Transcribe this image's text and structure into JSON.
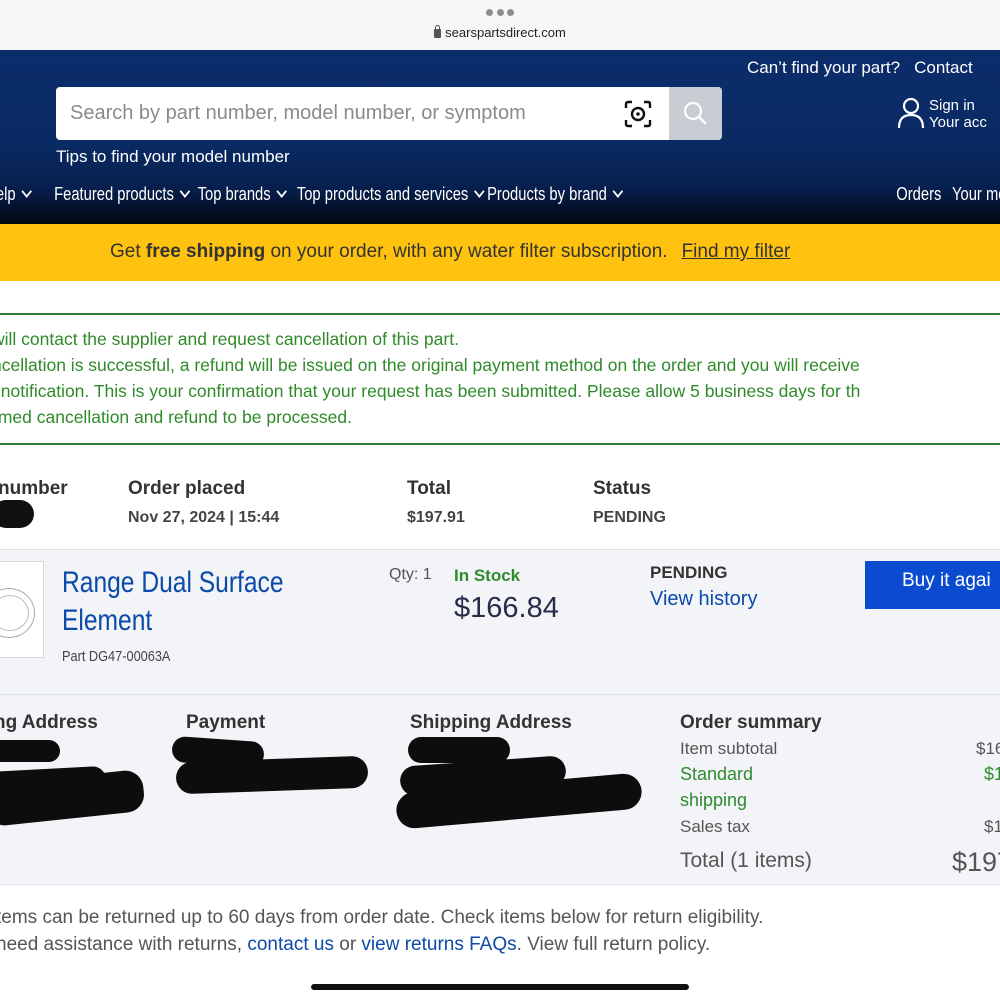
{
  "browser": {
    "url": "searspartsdirect.com"
  },
  "header": {
    "top_links": [
      "Can’t find your part?",
      "Contact"
    ],
    "search_placeholder": "Search by part number, model number, or symptom",
    "tips_link": "Tips to find your model number",
    "sign_in_line1": "Sign in",
    "sign_in_line2": "Your acc",
    "nav": [
      "elp",
      "Featured products",
      "Top brands",
      "Top products and services",
      "Products by brand"
    ],
    "nav_right": [
      "Orders",
      "Your mo"
    ]
  },
  "promo": {
    "prefix": "Get ",
    "bold": "free shipping",
    "suffix": " on your order, with any water filter subscription.",
    "link": "Find my filter"
  },
  "notice": {
    "lines": [
      "will contact the supplier and request cancellation of this part.",
      "ncellation is successful, a refund will be issued on the original payment method on the order and you will receive",
      "l notification. This is your confirmation that your request has been submitted. Please allow 5 business days for th",
      "rmed cancellation and refund to be processed."
    ]
  },
  "order": {
    "number_label": "number",
    "placed_label": "Order placed",
    "placed_value": "Nov 27, 2024 | 15:44",
    "total_label": "Total",
    "total_value": "$197.91",
    "status_label": "Status",
    "status_value": "PENDING"
  },
  "item": {
    "name": "Range Dual Surface Element",
    "part": "Part DG47-00063A",
    "qty": "Qty: 1",
    "stock": "In Stock",
    "price": "$166.84",
    "status": "PENDING",
    "history_link": "View history",
    "buy_again": "Buy it agai"
  },
  "details": {
    "billing_label": "ng Address",
    "payment_label": "Payment",
    "shipping_label": "Shipping Address",
    "summary_label": "Order summary",
    "subtotal_label": "Item subtotal",
    "subtotal_value": "$16",
    "shipping_line1": "Standard",
    "shipping_line2": "shipping",
    "shipping_value": "$1",
    "tax_label": "Sales tax",
    "tax_value": "$1",
    "total_label": "Total (1 items)",
    "total_value": "$197"
  },
  "returns": {
    "line1": "tems can be returned up to 60 days from order date. Check items below for return eligibility.",
    "line2_prefix": "need assistance with returns, ",
    "contact_link": "contact us",
    "or": " or ",
    "faq_link": "view returns FAQs",
    "line2_suffix": ". View full return policy."
  }
}
